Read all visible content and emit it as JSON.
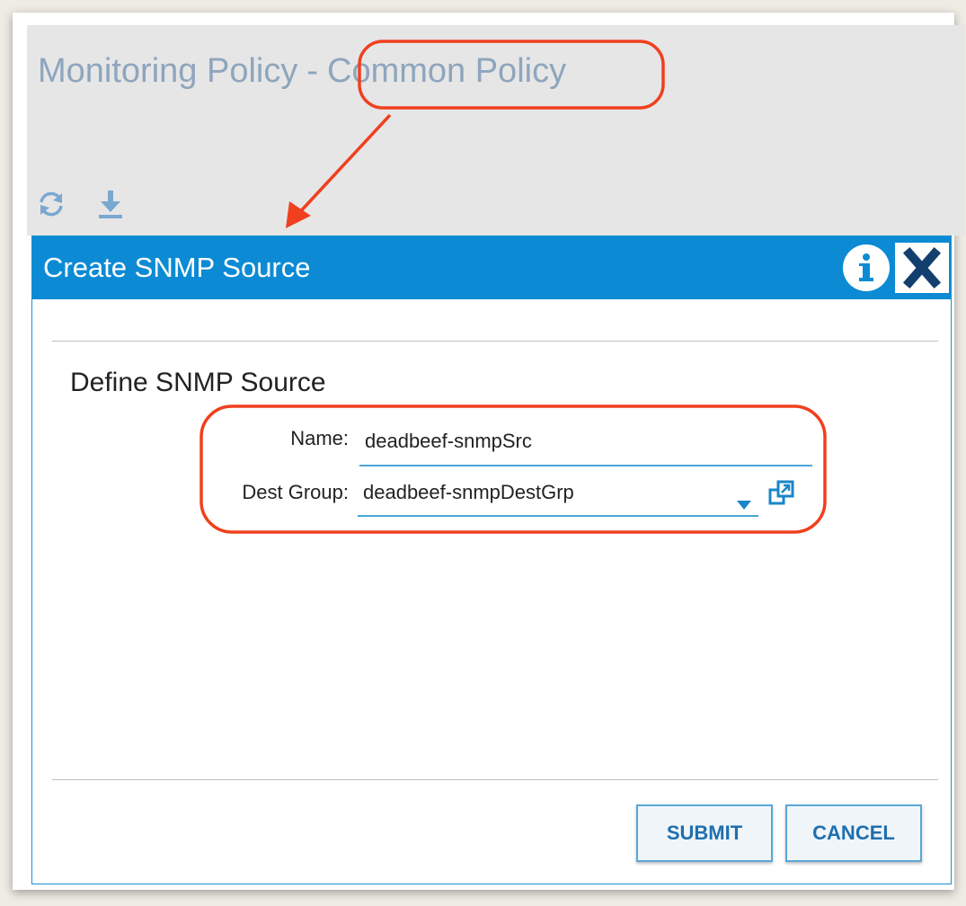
{
  "page": {
    "title_prefix": "Monitoring Policy",
    "title_separator": "-",
    "title_highlight": "Common Policy"
  },
  "toolbar": {
    "refresh_icon": "refresh-icon",
    "download_icon": "download-icon"
  },
  "dialog": {
    "title": "Create SNMP Source",
    "info_icon": "info-icon",
    "close_icon": "close-icon",
    "section_title": "Define SNMP Source",
    "fields": {
      "name": {
        "label": "Name:",
        "value": "deadbeef-snmpSrc"
      },
      "dest_group": {
        "label": "Dest Group:",
        "value": "deadbeef-snmpDestGrp"
      }
    },
    "buttons": {
      "submit": "SUBMIT",
      "cancel": "CANCEL"
    }
  },
  "colors": {
    "accent": "#0c8bd4",
    "annotation": "#f0401e",
    "title_text": "#8ea5bd"
  }
}
